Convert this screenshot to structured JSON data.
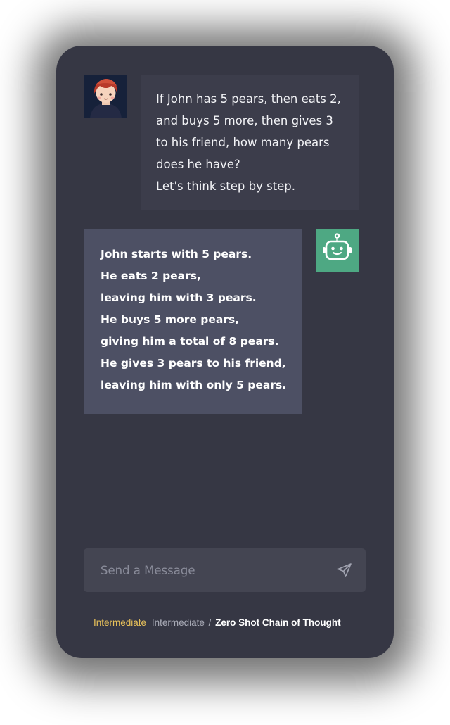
{
  "conversation": {
    "user_message": {
      "lines": [
        "If John has 5 pears, then eats 2,",
        "and buys 5 more, then gives 3",
        "to his friend, how many pears",
        "does he have?",
        "Let's think step by step."
      ],
      "avatar_icon": "user-avatar-icon"
    },
    "bot_message": {
      "lines": [
        "John starts with 5 pears.",
        "He eats 2 pears,",
        "leaving him with 3 pears.",
        "He buys 5 more pears,",
        "giving him a total of 8 pears.",
        "He gives 3 pears to his friend,",
        "leaving him with only 5 pears."
      ],
      "avatar_icon": "robot-icon",
      "avatar_color": "#4ea883"
    }
  },
  "composer": {
    "placeholder": "Send a Message",
    "value": "",
    "send_icon": "send-icon"
  },
  "breadcrumb": {
    "level": "Intermediate",
    "section": "Intermediate",
    "separator": "/",
    "current": "Zero Shot Chain of Thought"
  },
  "colors": {
    "panel_bg": "#363744",
    "user_bubble": "#3c3d4b",
    "bot_bubble": "#4d5064",
    "accent_level": "#e8c15a"
  }
}
